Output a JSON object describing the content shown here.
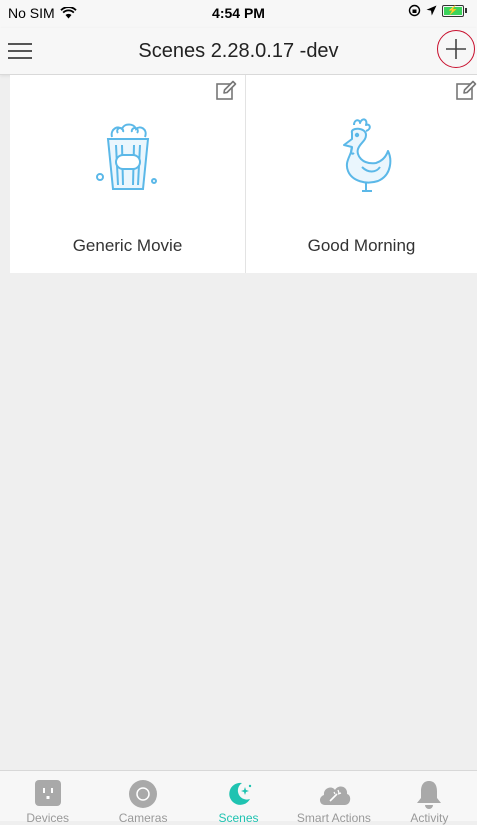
{
  "status_bar": {
    "carrier": "No SIM",
    "time": "4:54 PM"
  },
  "header": {
    "title": "Scenes 2.28.0.17 -dev",
    "add_icon": "plus-icon",
    "menu_icon": "hamburger-icon"
  },
  "scenes": [
    {
      "label": "Generic Movie",
      "icon": "popcorn-icon",
      "edit_icon": "edit-icon"
    },
    {
      "label": "Good Morning",
      "icon": "rooster-icon",
      "edit_icon": "edit-icon"
    }
  ],
  "tabs": [
    {
      "label": "Devices",
      "icon": "outlet-icon",
      "active": false
    },
    {
      "label": "Cameras",
      "icon": "camera-icon",
      "active": false
    },
    {
      "label": "Scenes",
      "icon": "scenes-icon",
      "active": true
    },
    {
      "label": "Smart Actions",
      "icon": "smart-actions-icon",
      "active": false
    },
    {
      "label": "Activity",
      "icon": "bell-icon",
      "active": false
    }
  ],
  "colors": {
    "accent": "#1fc3b1",
    "highlight_circle": "#c8102e",
    "scene_icon": "#5bb8e8"
  }
}
